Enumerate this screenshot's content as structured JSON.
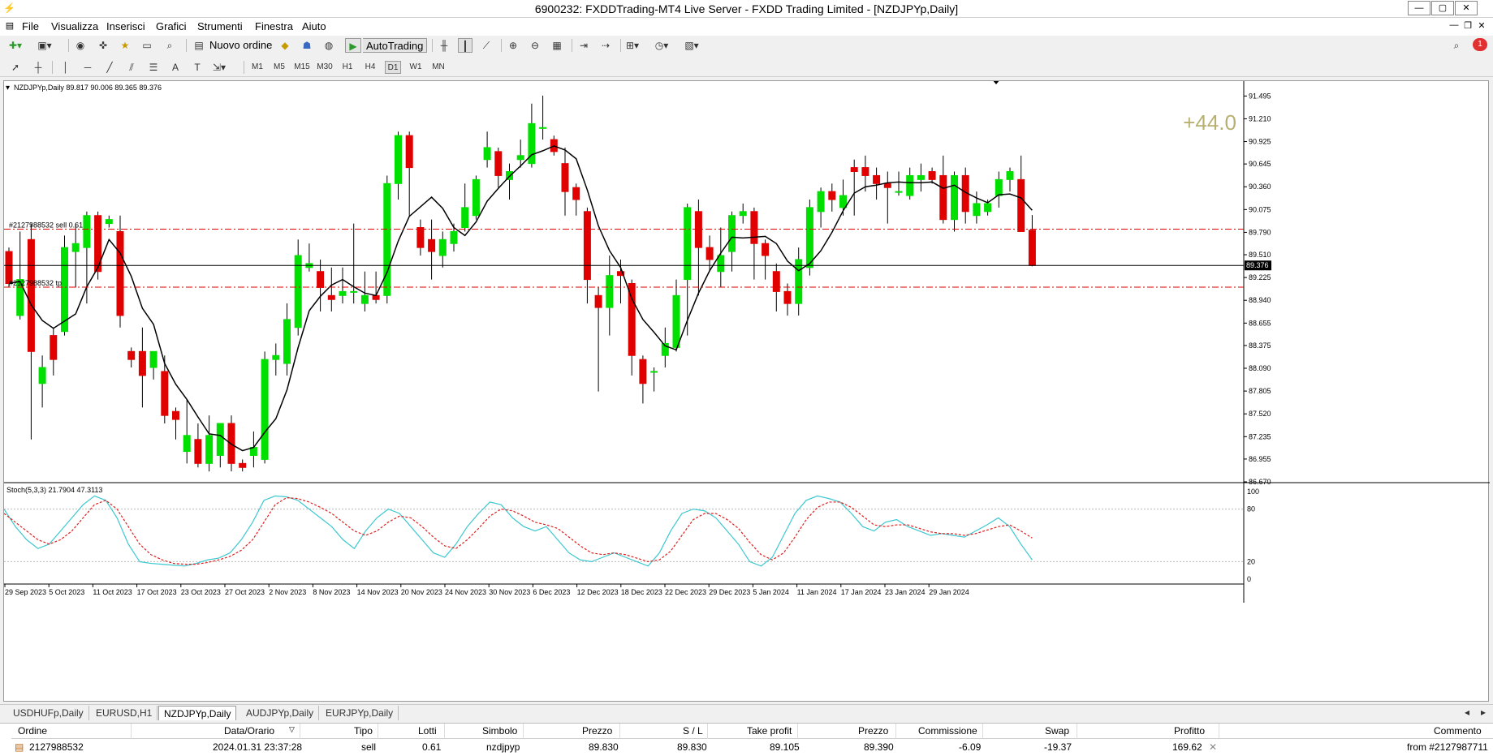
{
  "window": {
    "title": "6900232: FXDDTrading-MT4 Live Server - FXDD Trading Limited - [NZDJPYp,Daily]",
    "min_label": "—",
    "max_label": "▢",
    "close_label": "✕"
  },
  "menu": [
    "File",
    "Visualizza",
    "Inserisci",
    "Grafici",
    "Strumenti",
    "Finestra",
    "Aiuto"
  ],
  "toolbar": {
    "new_order_label": "Nuovo ordine",
    "autotrading_label": "AutoTrading",
    "timeframes": [
      "M1",
      "M5",
      "M15",
      "M30",
      "H1",
      "H4",
      "D1",
      "W1",
      "MN"
    ],
    "active_timeframe": "D1",
    "notification_count": "1"
  },
  "chart": {
    "header": "NZDJPYp,Daily  89.817 90.006 89.365 89.376",
    "profit_overlay": "+44.0",
    "order_sell_label": "#2127988532 sell 0.61",
    "order_tp_label": "#2127988532 tp",
    "current_price_label": "89.376",
    "stoch_label": "Stoch(5,3,3) 21.7904 47.3113",
    "accent_up": "#00e000",
    "accent_down": "#e00000"
  },
  "chart_data": {
    "type": "candlestick",
    "symbol": "NZDJPYp",
    "timeframe": "Daily",
    "y_ticks": [
      "91.495",
      "91.210",
      "90.925",
      "90.645",
      "90.360",
      "90.075",
      "89.790",
      "89.510",
      "89.225",
      "88.940",
      "88.655",
      "88.375",
      "88.090",
      "87.805",
      "87.520",
      "87.235",
      "86.955",
      "86.670"
    ],
    "ylim": [
      86.67,
      91.6
    ],
    "x_labels": [
      "29 Sep 2023",
      "5 Oct 2023",
      "11 Oct 2023",
      "17 Oct 2023",
      "23 Oct 2023",
      "27 Oct 2023",
      "2 Nov 2023",
      "8 Nov 2023",
      "14 Nov 2023",
      "20 Nov 2023",
      "24 Nov 2023",
      "30 Nov 2023",
      "6 Dec 2023",
      "12 Dec 2023",
      "18 Dec 2023",
      "22 Dec 2023",
      "29 Dec 2023",
      "5 Jan 2024",
      "11 Jan 2024",
      "17 Jan 2024",
      "23 Jan 2024",
      "29 Jan 2024"
    ],
    "candles": [
      [
        89.55,
        89.15,
        89.6,
        89.1
      ],
      [
        88.75,
        89.2,
        89.8,
        88.7
      ],
      [
        89.7,
        88.3,
        89.9,
        87.2
      ],
      [
        87.9,
        88.1,
        88.25,
        87.6
      ],
      [
        88.5,
        88.2,
        88.6,
        88.0
      ],
      [
        88.55,
        89.6,
        89.75,
        88.5
      ],
      [
        89.55,
        89.65,
        89.9,
        89.1
      ],
      [
        89.6,
        90.0,
        90.05,
        88.9
      ],
      [
        90.0,
        89.3,
        90.05,
        89.2
      ],
      [
        89.9,
        89.95,
        90.0,
        89.85
      ],
      [
        89.8,
        88.75,
        90.0,
        88.6
      ],
      [
        88.3,
        88.2,
        88.35,
        88.1
      ],
      [
        88.3,
        88.0,
        88.6,
        87.6
      ],
      [
        88.1,
        88.3,
        88.2,
        87.95
      ],
      [
        88.05,
        87.5,
        88.25,
        87.4
      ],
      [
        87.55,
        87.45,
        87.6,
        87.2
      ],
      [
        87.05,
        87.25,
        87.7,
        86.9
      ],
      [
        87.2,
        86.9,
        87.4,
        86.85
      ],
      [
        86.9,
        87.25,
        87.5,
        86.8
      ],
      [
        87.0,
        87.4,
        87.4,
        86.85
      ],
      [
        87.4,
        86.9,
        87.5,
        86.8
      ],
      [
        86.9,
        86.85,
        86.95,
        86.8
      ],
      [
        87.0,
        87.1,
        87.3,
        86.85
      ],
      [
        86.95,
        88.2,
        88.3,
        86.9
      ],
      [
        88.2,
        88.25,
        88.4,
        88.0
      ],
      [
        88.15,
        88.7,
        88.9,
        88.0
      ],
      [
        88.6,
        89.5,
        89.7,
        88.5
      ],
      [
        89.35,
        89.4,
        89.65,
        89.3
      ],
      [
        89.3,
        89.1,
        89.45,
        88.8
      ],
      [
        89.0,
        88.95,
        89.35,
        88.8
      ],
      [
        89.0,
        89.05,
        89.35,
        88.9
      ],
      [
        89.05,
        89.05,
        89.9,
        88.9
      ],
      [
        88.9,
        89.0,
        89.3,
        88.8
      ],
      [
        89.0,
        88.95,
        89.3,
        88.9
      ],
      [
        89.0,
        90.4,
        90.5,
        88.9
      ],
      [
        90.4,
        91.0,
        91.05,
        90.2
      ],
      [
        91.0,
        90.6,
        91.05,
        90.0
      ],
      [
        89.85,
        89.6,
        89.95,
        89.5
      ],
      [
        89.7,
        89.55,
        89.95,
        89.2
      ],
      [
        89.5,
        89.7,
        89.8,
        89.35
      ],
      [
        89.65,
        89.8,
        89.9,
        89.55
      ],
      [
        89.85,
        90.1,
        90.4,
        89.8
      ],
      [
        90.0,
        90.45,
        90.5,
        89.95
      ],
      [
        90.7,
        90.85,
        91.05,
        90.6
      ],
      [
        90.8,
        90.5,
        90.85,
        90.35
      ],
      [
        90.45,
        90.55,
        90.65,
        90.2
      ],
      [
        90.7,
        90.75,
        90.95,
        90.6
      ],
      [
        90.65,
        91.15,
        91.4,
        90.6
      ],
      [
        91.1,
        91.1,
        91.5,
        90.95
      ],
      [
        90.95,
        90.8,
        91.0,
        90.75
      ],
      [
        90.65,
        90.3,
        90.85,
        90.0
      ],
      [
        90.35,
        90.2,
        90.4,
        90.0
      ],
      [
        90.05,
        89.2,
        90.1,
        88.9
      ],
      [
        89.0,
        88.85,
        89.1,
        87.8
      ],
      [
        88.85,
        89.25,
        89.5,
        88.5
      ],
      [
        89.3,
        89.25,
        89.45,
        88.9
      ],
      [
        89.15,
        88.25,
        89.2,
        88.0
      ],
      [
        88.2,
        87.9,
        88.25,
        87.65
      ],
      [
        88.05,
        88.05,
        88.1,
        87.8
      ],
      [
        88.25,
        88.4,
        88.6,
        88.1
      ],
      [
        88.35,
        89.0,
        89.2,
        88.3
      ],
      [
        89.2,
        90.1,
        90.15,
        88.5
      ],
      [
        90.05,
        89.6,
        90.2,
        89.0
      ],
      [
        89.6,
        89.45,
        89.75,
        89.3
      ],
      [
        89.3,
        89.5,
        89.85,
        89.1
      ],
      [
        89.55,
        90.0,
        90.05,
        89.3
      ],
      [
        90.0,
        90.05,
        90.15,
        89.9
      ],
      [
        90.05,
        89.65,
        90.1,
        89.2
      ],
      [
        89.65,
        89.5,
        89.7,
        89.2
      ],
      [
        89.3,
        89.05,
        89.4,
        88.8
      ],
      [
        89.05,
        88.9,
        89.15,
        88.75
      ],
      [
        88.9,
        89.45,
        89.6,
        88.75
      ],
      [
        89.35,
        90.1,
        90.2,
        89.25
      ],
      [
        90.05,
        90.3,
        90.35,
        89.85
      ],
      [
        90.3,
        90.2,
        90.4,
        90.05
      ],
      [
        90.1,
        90.25,
        90.45,
        90.0
      ],
      [
        90.6,
        90.55,
        90.7,
        90.0
      ],
      [
        90.6,
        90.5,
        90.75,
        90.3
      ],
      [
        90.5,
        90.4,
        90.6,
        90.2
      ],
      [
        90.4,
        90.35,
        90.55,
        89.9
      ],
      [
        90.3,
        90.3,
        90.55,
        90.25
      ],
      [
        90.25,
        90.5,
        90.6,
        90.2
      ],
      [
        90.45,
        90.5,
        90.65,
        90.3
      ],
      [
        90.55,
        90.45,
        90.6,
        90.4
      ],
      [
        90.5,
        89.95,
        90.75,
        89.9
      ],
      [
        89.95,
        90.5,
        90.55,
        89.8
      ],
      [
        90.5,
        90.05,
        90.6,
        89.9
      ],
      [
        90.0,
        90.15,
        90.3,
        89.9
      ],
      [
        90.05,
        90.15,
        90.2,
        90.0
      ],
      [
        90.25,
        90.45,
        90.55,
        90.1
      ],
      [
        90.45,
        90.55,
        90.6,
        90.3
      ],
      [
        90.45,
        89.8,
        90.75,
        89.8
      ],
      [
        89.817,
        89.376,
        90.006,
        89.365
      ]
    ],
    "sma_period_estimate": "",
    "stochastic": {
      "ylim": [
        0,
        100
      ],
      "levels": [
        20,
        80
      ],
      "tick_labels": [
        "100",
        "80",
        "20",
        "0"
      ],
      "main": [
        80,
        60,
        45,
        35,
        40,
        55,
        70,
        85,
        95,
        90,
        70,
        40,
        20,
        18,
        17,
        16,
        15,
        18,
        22,
        24,
        30,
        45,
        65,
        90,
        95,
        94,
        90,
        80,
        70,
        60,
        45,
        35,
        55,
        70,
        80,
        75,
        60,
        45,
        30,
        25,
        40,
        60,
        75,
        88,
        85,
        70,
        60,
        55,
        60,
        45,
        30,
        22,
        20,
        25,
        30,
        25,
        20,
        15,
        30,
        55,
        75,
        80,
        78,
        70,
        55,
        40,
        20,
        15,
        25,
        50,
        75,
        90,
        95,
        92,
        88,
        75,
        60,
        55,
        65,
        68,
        60,
        55,
        50,
        52,
        50,
        48,
        55,
        62,
        70,
        60,
        40,
        22
      ],
      "signal": [
        75,
        65,
        55,
        45,
        40,
        45,
        55,
        70,
        85,
        90,
        80,
        60,
        40,
        28,
        22,
        18,
        17,
        17,
        19,
        22,
        26,
        33,
        45,
        65,
        85,
        93,
        92,
        88,
        82,
        75,
        65,
        55,
        50,
        55,
        65,
        72,
        70,
        60,
        48,
        38,
        35,
        45,
        58,
        72,
        80,
        78,
        72,
        65,
        62,
        58,
        48,
        38,
        30,
        28,
        30,
        28,
        24,
        20,
        22,
        32,
        50,
        68,
        75,
        75,
        68,
        58,
        42,
        28,
        22,
        30,
        48,
        68,
        82,
        88,
        88,
        82,
        72,
        62,
        60,
        62,
        62,
        58,
        54,
        52,
        52,
        50,
        52,
        56,
        60,
        62,
        55,
        47
      ]
    }
  },
  "tabs": [
    "USDHUFp,Daily",
    "EURUSD,H1",
    "NZDJPYp,Daily",
    "AUDJPYp,Daily",
    "EURJPYp,Daily"
  ],
  "active_tab": "NZDJPYp,Daily",
  "terminal": {
    "headers": [
      "Ordine",
      "Data/Orario",
      "Tipo",
      "Lotti",
      "Simbolo",
      "Prezzo",
      "S / L",
      "Take profit",
      "Prezzo",
      "Commissione",
      "Swap",
      "Profitto",
      "Commento"
    ],
    "row": [
      "2127988532",
      "2024.01.31 23:37:28",
      "sell",
      "0.61",
      "nzdjpyp",
      "89.830",
      "89.830",
      "89.105",
      "89.390",
      "-6.09",
      "-19.37",
      "169.62",
      "from #2127987711"
    ]
  }
}
